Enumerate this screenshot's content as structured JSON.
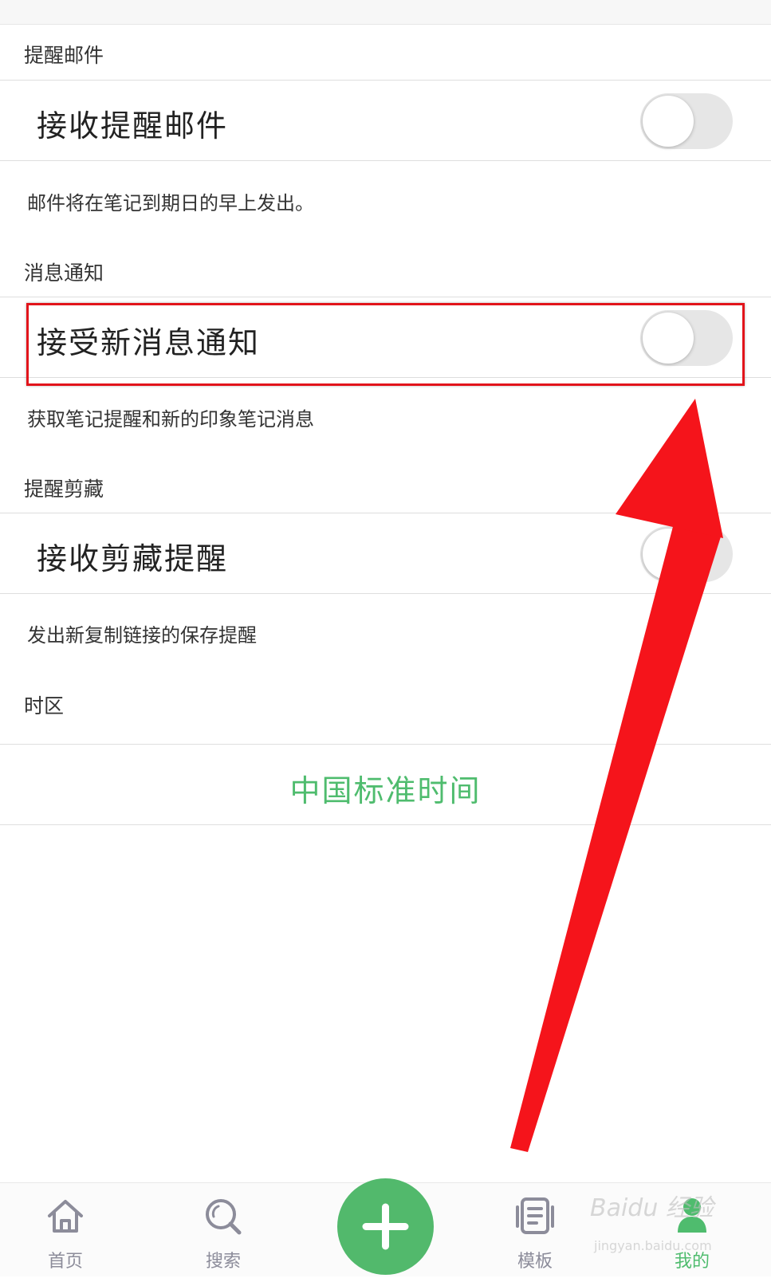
{
  "sections": {
    "email": {
      "header": "提醒邮件",
      "row_label": "接收提醒邮件",
      "hint": "邮件将在笔记到期日的早上发出。",
      "enabled": false
    },
    "notification": {
      "header": "消息通知",
      "row_label": "接受新消息通知",
      "hint": "获取笔记提醒和新的印象笔记消息",
      "enabled": false
    },
    "clip": {
      "header": "提醒剪藏",
      "row_label": "接收剪藏提醒",
      "hint": "发出新复制链接的保存提醒",
      "enabled": false
    },
    "timezone": {
      "header": "时区",
      "value": "中国标准时间"
    }
  },
  "tabbar": {
    "tabs": [
      {
        "label": "首页",
        "icon": "home-icon",
        "active": false
      },
      {
        "label": "搜索",
        "icon": "search-icon",
        "active": false
      },
      {
        "label": "模板",
        "icon": "template-icon",
        "active": false
      },
      {
        "label": "我的",
        "icon": "profile-icon",
        "active": true
      }
    ],
    "add_icon": "plus-icon"
  },
  "watermark": {
    "brand": "Baidu 经验",
    "url": "jingyan.baidu.com"
  },
  "colors": {
    "accent_green": "#4fbc6e",
    "annotation_red": "#e2141b",
    "toggle_off": "#e6e6e6"
  }
}
